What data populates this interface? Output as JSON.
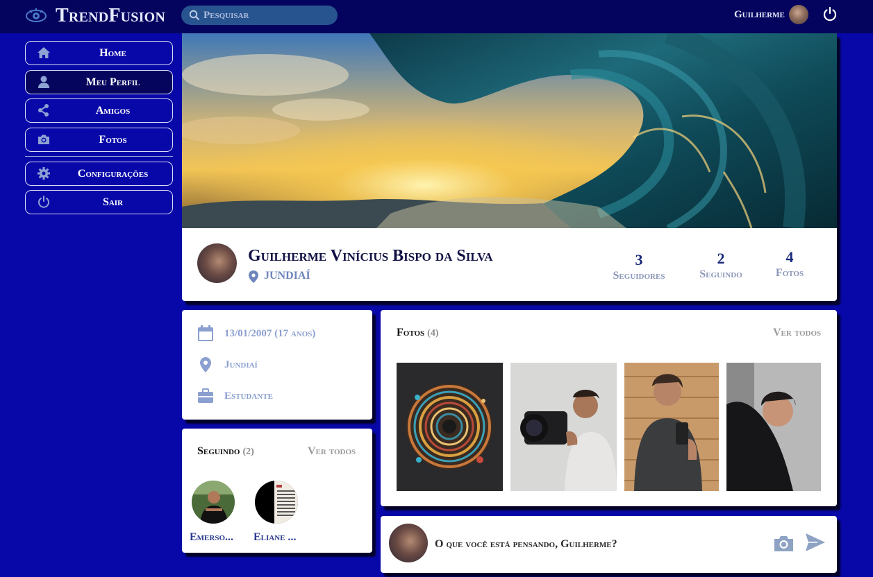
{
  "app": {
    "title": "TrendFusion"
  },
  "search": {
    "placeholder": "Pesquisar"
  },
  "user": {
    "name": "Guilherme"
  },
  "sidebar": {
    "items": [
      {
        "label": "Home",
        "icon": "home-icon"
      },
      {
        "label": "Meu Perfil",
        "icon": "user-icon",
        "active": true
      },
      {
        "label": "Amigos",
        "icon": "share-icon"
      },
      {
        "label": "Fotos",
        "icon": "camera-icon"
      },
      {
        "label": "Configurações",
        "icon": "gear-icon"
      },
      {
        "label": "Sair",
        "icon": "power-icon"
      }
    ]
  },
  "profile": {
    "name": "Guilherme Vinícius Bispo da Silva",
    "location": "JUNDIAÍ",
    "stats": [
      {
        "value": "3",
        "label": "Seguidores"
      },
      {
        "value": "2",
        "label": "Seguindo"
      },
      {
        "value": "4",
        "label": "Fotos"
      }
    ]
  },
  "info": {
    "birthdate": "13/01/2007 (17 anos)",
    "city": "Jundiaí",
    "occupation": "Estudante"
  },
  "following": {
    "title": "Seguindo",
    "count": "(2)",
    "see_all": "Ver todos",
    "people": [
      {
        "name": "Emerso..."
      },
      {
        "name": "Eliane ..."
      }
    ]
  },
  "photos": {
    "title": "Fotos",
    "count": "(4)",
    "see_all": "Ver todos"
  },
  "composer": {
    "placeholder": "O que você está pensando, Guilherme?"
  },
  "colors": {
    "background": "#0808a8",
    "topbar": "#04045e",
    "accent": "#6f86bc"
  }
}
